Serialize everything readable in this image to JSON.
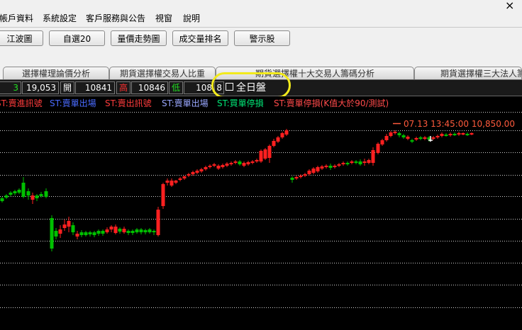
{
  "menu": [
    "帳戶資料",
    "系統設定",
    "客戶服務與公告",
    "視窗",
    "說明"
  ],
  "window_close": "×",
  "toolbar": [
    "江波圖",
    "自選20",
    "量價走勢圖",
    "成交量排名",
    "警示股"
  ],
  "tabs": [
    "選擇權理論價分析",
    "期貨選擇權交易人比重",
    "期貨選擇權十大交易人籌碼分析",
    "期貨選擇權三大法人籌"
  ],
  "quote": {
    "qty": "3",
    "last": "19,053",
    "open_label": "開",
    "open": "10841",
    "high_label": "高",
    "high": "10846",
    "low_label": "低",
    "low": "108",
    "extra": "8"
  },
  "all_day_label": "全日盤",
  "legend": [
    {
      "text": "ST:賣進訊號",
      "color": "#ff3c3c"
    },
    {
      "text": "ST:賣單出場",
      "color": "#4a6bff"
    },
    {
      "text": "ST:賣出訊號",
      "color": "#ff3c3c"
    },
    {
      "text": "ST:賣單出場",
      "color": "#9aa8ff"
    },
    {
      "text": "ST:買單停損",
      "color": "#00e676"
    },
    {
      "text": "ST:賣單停損(K值大於90/測試)",
      "color": "#ff4a4a"
    }
  ],
  "chart_data": {
    "type": "candlestick",
    "last_marker": {
      "time": "07.13 13:45:00",
      "value": "10,850.00"
    },
    "up_color": "#ff2020",
    "down_color": "#00c000",
    "grid": true
  }
}
